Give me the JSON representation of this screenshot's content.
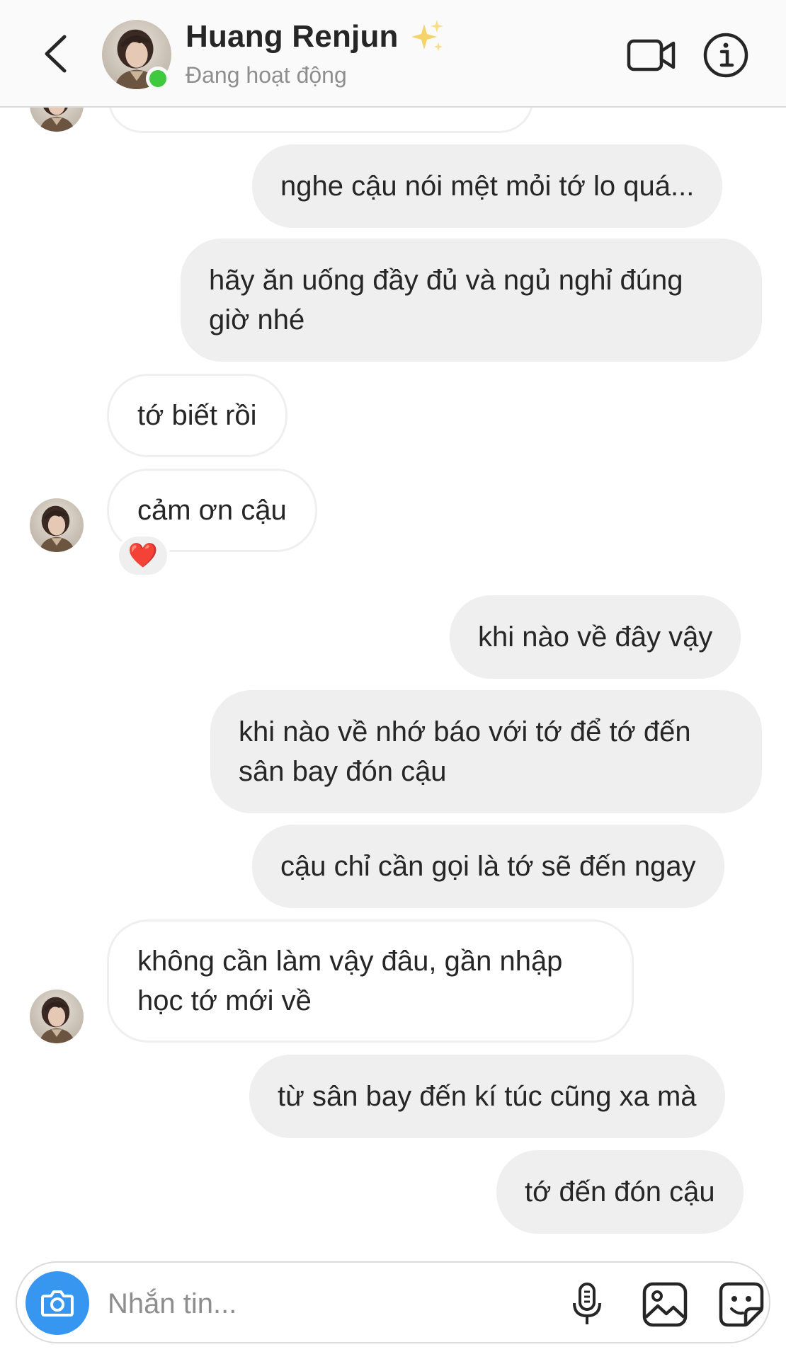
{
  "header": {
    "back_icon": "chevron-left-icon",
    "contact_name": "Huang Renjun",
    "name_emoji": "sparkles",
    "status": "Đang hoạt động",
    "video_icon": "video-camera-icon",
    "info_icon": "info-icon"
  },
  "messages": [
    {
      "side": "in",
      "text": "",
      "partial": true
    },
    {
      "side": "out",
      "text": "nghe cậu nói mệt mỏi tớ lo quá..."
    },
    {
      "side": "out",
      "lines": [
        "hãy ăn uống đầy đủ và ngủ nghỉ đúng",
        "giờ nhé"
      ]
    },
    {
      "side": "in",
      "text": "tớ biết rồi"
    },
    {
      "side": "in",
      "text": "cảm ơn cậu",
      "reaction": "❤️"
    },
    {
      "side": "out",
      "text": "khi nào về đây vậy"
    },
    {
      "side": "out",
      "lines": [
        "khi nào về nhớ báo với tớ để tớ đến",
        "sân bay đón cậu"
      ]
    },
    {
      "side": "out",
      "text": "cậu chỉ cần gọi là tớ sẽ đến ngay"
    },
    {
      "side": "in",
      "lines": [
        "không cần làm vậy đâu, gần nhập",
        "học tớ mới về"
      ]
    },
    {
      "side": "out",
      "text": "từ sân bay đến kí túc cũng xa mà"
    },
    {
      "side": "out",
      "text": "tớ đến đón cậu"
    }
  ],
  "composer": {
    "placeholder": "Nhắn tin...",
    "camera_icon": "camera-icon",
    "mic_icon": "microphone-icon",
    "gallery_icon": "image-icon",
    "sticker_icon": "sticker-icon"
  },
  "colors": {
    "outgoing_bubble": "#efefef",
    "incoming_border": "#efefef",
    "camera_button": "#3797f0",
    "online_dot": "#3ec93e",
    "secondary_text": "#8e8e8e"
  }
}
